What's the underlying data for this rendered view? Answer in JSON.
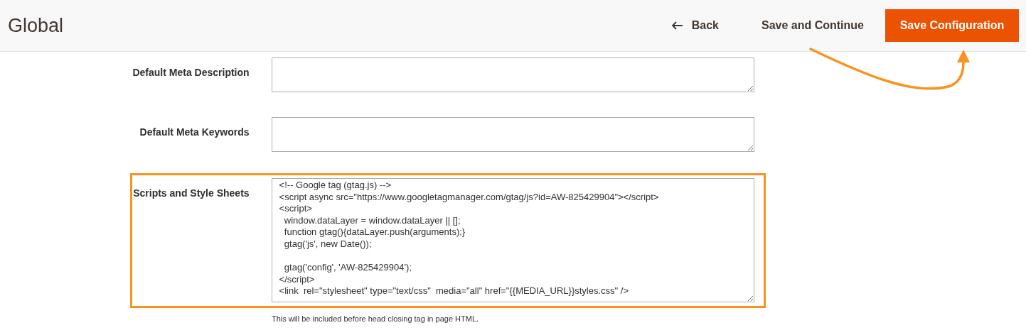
{
  "header": {
    "title": "Global",
    "back": "Back",
    "save_continue": "Save and Continue",
    "save_config": "Save Configuration"
  },
  "fields": [
    {
      "label": "Default Meta Description",
      "highlighted": false
    },
    {
      "label": "Default Meta Keywords",
      "highlighted": false
    },
    {
      "label": "Scripts and Style Sheets",
      "value": "<!-- Google tag (gtag.js) -->\n<script async src=\"https://www.googletagmanager.com/gtag/js?id=AW-825429904\"></script>\n<script>\n  window.dataLayer = window.dataLayer || [];\n  function gtag(){dataLayer.push(arguments);}\n  gtag('js', new Date());\n\n  gtag('config', 'AW-825429904');\n</script>\n<link  rel=\"stylesheet\" type=\"text/css\"  media=\"all\" href=\"{{MEDIA_URL}}styles.css\" />",
      "highlighted": true,
      "note": "This will be included before head closing tag in page HTML."
    }
  ]
}
